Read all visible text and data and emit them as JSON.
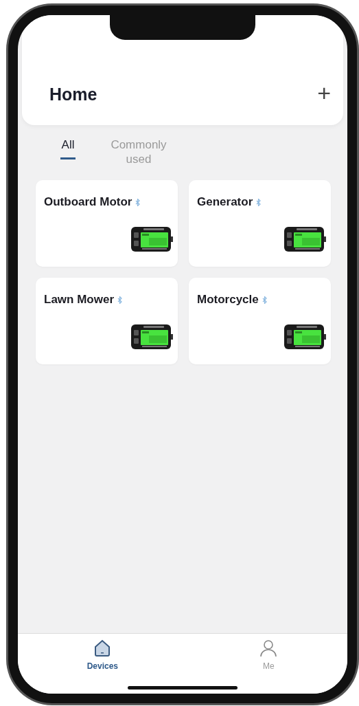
{
  "header": {
    "title": "Home",
    "add_label": "+"
  },
  "tabs": [
    {
      "label": "All",
      "selected": true
    },
    {
      "label": "Commonly used",
      "selected": false
    }
  ],
  "devices": [
    {
      "name": "Outboard Motor",
      "connected": true
    },
    {
      "name": "Generator",
      "connected": true
    },
    {
      "name": "Lawn Mower",
      "connected": true
    },
    {
      "name": "Motorcycle",
      "connected": true
    }
  ],
  "nav": [
    {
      "label": "Devices",
      "kind": "home",
      "selected": true
    },
    {
      "label": "Me",
      "kind": "person",
      "selected": false
    }
  ]
}
